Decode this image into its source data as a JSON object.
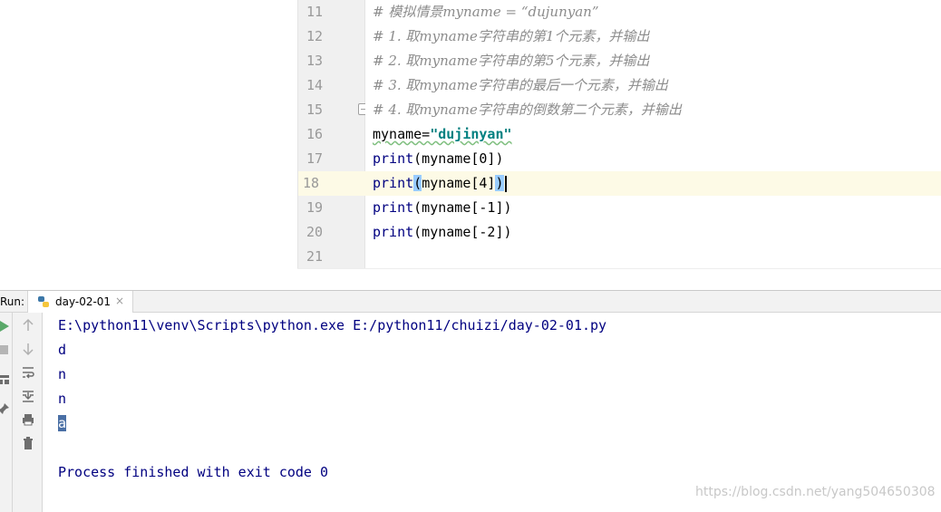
{
  "editor": {
    "line_numbers": [
      "11",
      "12",
      "13",
      "14",
      "15",
      "16",
      "17",
      "18",
      "19",
      "20",
      "21"
    ],
    "current_line": "18",
    "lines": {
      "l11": "# 模拟情景myname = “dujunyan”",
      "l12": "# 1. 取myname字符串的第1个元素，并输出",
      "l13": "# 2. 取myname字符串的第5个元素，并输出",
      "l14": "# 3. 取myname字符串的最后一个元素，并输出",
      "l15": "# 4. 取myname字符串的倒数第二个元素，并输出",
      "l16_var": "myname=",
      "l16_str": "\"dujinyan\"",
      "l17_fn": "print",
      "l17_args": "(myname[0])",
      "l18_fn": "print",
      "l18_open": "(",
      "l18_mid": "myname[4]",
      "l18_close": ")",
      "l19_fn": "print",
      "l19_args": "(myname[-1])",
      "l20_fn": "print",
      "l20_args": "(myname[-2])"
    }
  },
  "run": {
    "label": "Run:",
    "tab_label": "day-02-01",
    "tab_close": "×",
    "console_lines": {
      "cmd": "E:\\python11\\venv\\Scripts\\python.exe E:/python11/chuizi/day-02-01.py",
      "o1": "d",
      "o2": "n",
      "o3": "n",
      "o4": "a",
      "finished": "Process finished with exit code 0"
    },
    "icons": [
      "run-icon",
      "stop-icon",
      "layout-icon",
      "pin-icon",
      "up-arrow-icon",
      "down-arrow-icon",
      "soft-wrap-icon",
      "scroll-to-end-icon",
      "print-icon",
      "trash-icon"
    ]
  },
  "watermark": "https://blog.csdn.net/yang504650308",
  "colors": {
    "comment": "#8c8c8c",
    "string": "#008080",
    "keyword": "#000080",
    "current_line_bg": "#fdfae6",
    "selection": "#4a6fa5"
  }
}
